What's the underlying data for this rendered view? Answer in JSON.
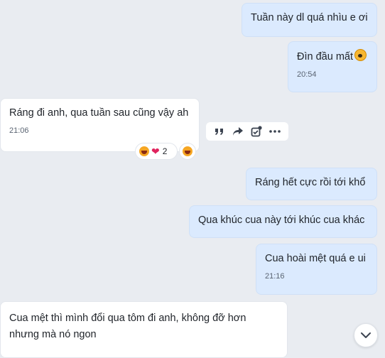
{
  "messages": [
    {
      "text": "Tuần này dl quá nhìu e ơi",
      "time": ""
    },
    {
      "text": "Đìn đầu mất",
      "time": "20:54"
    },
    {
      "text": "Ráng đi anh, qua tuần sau cũng vậy ah",
      "time": "21:06"
    },
    {
      "text": "Ráng hết cực rồi tới khổ",
      "time": ""
    },
    {
      "text": "Qua khúc cua này tới khúc cua khác",
      "time": ""
    },
    {
      "text": "Cua hoài mệt quá e ui",
      "time": "21:16"
    },
    {
      "text": "Cua mệt thì mình đổi qua tôm đi anh, không đỡ hơn nhưng mà nó ngon",
      "time": ""
    }
  ],
  "reactions": {
    "count": "2"
  },
  "icons": {
    "quote": "quote-icon",
    "forward": "forward-icon",
    "task": "add-task-icon",
    "more": "more-icon",
    "scroll": "chevron-down-icon"
  }
}
